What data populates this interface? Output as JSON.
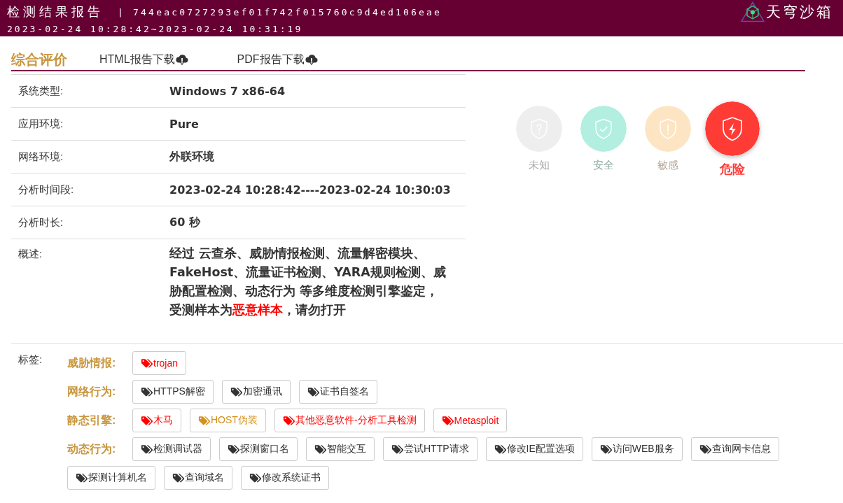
{
  "header": {
    "title": "检测结果报告",
    "sample_hash": "| 744eac0727293ef01f742f015760c9d4ed106eae",
    "time_range": "2023-02-24 10:28:42~2023-02-24 10:31:19",
    "logo_text": "天穹沙箱"
  },
  "toolbar": {
    "heading": "综合评价",
    "downloads": [
      {
        "label": "HTML报告下载"
      },
      {
        "label": "PDF报告下载"
      }
    ]
  },
  "info_rows": [
    {
      "kind": "text",
      "label": "系统类型:",
      "value": "Windows 7 x86-64"
    },
    {
      "kind": "text",
      "label": "应用环境:",
      "value": "Pure"
    },
    {
      "kind": "text",
      "label": "网络环境:",
      "value": "外联环境"
    },
    {
      "kind": "text",
      "label": "分析时间段:",
      "value": "2023-02-24 10:28:42----2023-02-24 10:30:03"
    },
    {
      "kind": "text",
      "label": "分析时长:",
      "value": "60 秒"
    },
    {
      "kind": "summary",
      "label": "概述:",
      "segments": [
        {
          "text": "经过 云查杀、威胁情报检测、流量解密模块、FakeHost、流量证书检测、YARA规则检测、威胁配置检测、动态行为 等多维度检测引擎鉴定，受测样本为",
          "highlight": false
        },
        {
          "text": "恶意样本",
          "highlight": true
        },
        {
          "text": "，请勿打开",
          "highlight": false
        }
      ]
    }
  ],
  "risk_levels": [
    {
      "kind": "unknown",
      "label": "未知",
      "color": "#eeeeee",
      "selected": false
    },
    {
      "kind": "safe",
      "label": "安全",
      "color": "#b3efe0",
      "selected": false
    },
    {
      "kind": "sensitive",
      "label": "敏感",
      "color": "#fde5c4",
      "selected": false
    },
    {
      "kind": "danger",
      "label": "危险",
      "color": "#ff3b36",
      "selected": true
    }
  ],
  "tags": {
    "label": "标签:",
    "groups": [
      {
        "name": "威胁情报:",
        "tags": [
          {
            "text": "trojan",
            "color": "#ff0000"
          }
        ]
      },
      {
        "name": "网络行为:",
        "tags": [
          {
            "text": "HTTPS解密",
            "color": "#333333"
          },
          {
            "text": "加密通讯",
            "color": "#333333"
          },
          {
            "text": "证书自签名",
            "color": "#333333"
          }
        ]
      },
      {
        "name": "静态引擎:",
        "tags": [
          {
            "text": "木马",
            "color": "#ff0000"
          },
          {
            "text": "HOST伪装",
            "color": "#d4921e"
          },
          {
            "text": "其他恶意软件-分析工具检测",
            "color": "#ff0000"
          },
          {
            "text": "Metasploit",
            "color": "#ff0000"
          }
        ]
      },
      {
        "name": "动态行为:",
        "tags": [
          {
            "text": "检测调试器",
            "color": "#333333"
          },
          {
            "text": "探测窗口名",
            "color": "#333333"
          },
          {
            "text": "智能交互",
            "color": "#333333"
          },
          {
            "text": "尝试HTTP请求",
            "color": "#333333"
          },
          {
            "text": "修改IE配置选项",
            "color": "#333333"
          },
          {
            "text": "访问WEB服务",
            "color": "#333333"
          },
          {
            "text": "查询网卡信息",
            "color": "#333333"
          },
          {
            "text": "探测计算机名",
            "color": "#333333"
          },
          {
            "text": "查询域名",
            "color": "#333333"
          },
          {
            "text": "修改系统证书",
            "color": "#333333"
          }
        ]
      }
    ]
  }
}
